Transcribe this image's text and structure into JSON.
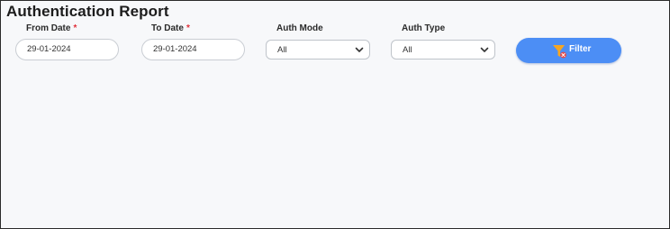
{
  "page": {
    "title": "Authentication Report"
  },
  "filters": {
    "from_date": {
      "label": "From Date",
      "required_mark": "*",
      "value": "29-01-2024"
    },
    "to_date": {
      "label": "To Date",
      "required_mark": "*",
      "value": "29-01-2024"
    },
    "auth_mode": {
      "label": "Auth Mode",
      "selected": "All",
      "icon": "chevron-down-icon"
    },
    "auth_type": {
      "label": "Auth Type",
      "selected": "All",
      "icon": "chevron-down-icon"
    },
    "filter_button": {
      "label": "Filter",
      "icon": "filter-icon"
    }
  },
  "colors": {
    "accent": "#4c8ef5",
    "required": "#e0313a",
    "filter_icon_funnel": "#f5a623",
    "filter_icon_badge": "#e64a4a",
    "background": "#f7f8fa"
  }
}
